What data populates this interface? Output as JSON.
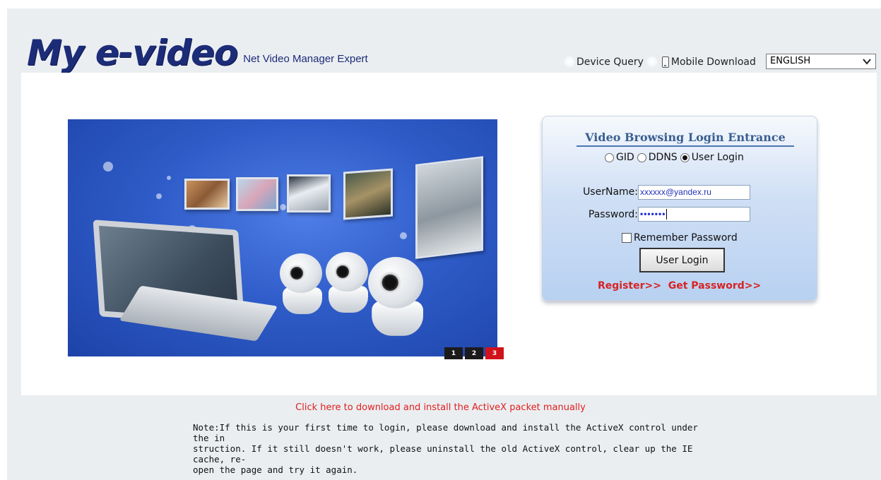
{
  "header": {
    "logo_main": "My e-video",
    "logo_sub": "Net Video Manager Expert",
    "device_query": "Device Query",
    "mobile_download": "Mobile Download",
    "language_selected": "ENGLISH"
  },
  "banner": {
    "slides": [
      "1",
      "2",
      "3"
    ],
    "active_slide": 3
  },
  "login": {
    "title": "Video Browsing Login Entrance",
    "modes": [
      "GID",
      "DDNS",
      "User Login"
    ],
    "selected_mode": "User Login",
    "username_label": "UserName:",
    "username_value": "xxxxxx@yandex.ru",
    "password_label": "Password:",
    "password_value": "•••••••",
    "remember_label": "Remember Password",
    "remember_checked": false,
    "login_button": "User Login",
    "register_link": "Register>>",
    "get_password_link": "Get Password>>"
  },
  "footer": {
    "activex_link": "Click here to download and install the ActiveX packet manually",
    "note": "Note:If this is your first time to login, please download and install the ActiveX control under the in\nstruction. If it still doesn't work, please uninstall the old ActiveX control, clear up the IE cache, re-\nopen the page and try it again."
  },
  "colors": {
    "logo": "#1c2c78",
    "link_red": "#d62323",
    "panel_title": "#3a5f90",
    "banner_blue": "#2f5cc8",
    "active_slide": "#d0121b"
  }
}
